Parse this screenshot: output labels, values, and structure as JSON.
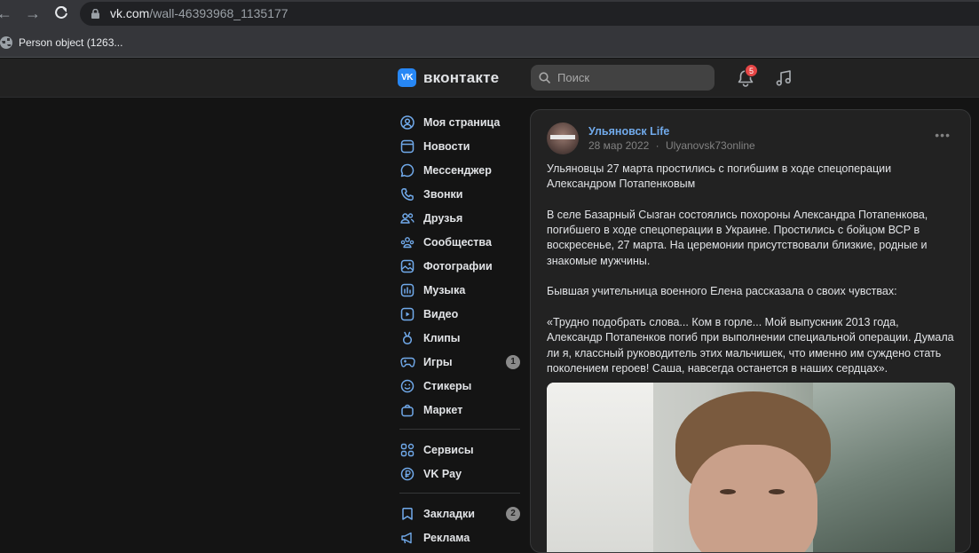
{
  "browser": {
    "url_host": "vk.com",
    "url_path": "/wall-46393968_1135177",
    "bookmark_label": "Person object (1263..."
  },
  "header": {
    "logo_text": "вконтакте",
    "search_placeholder": "Поиск",
    "notifications_count": "5"
  },
  "sidebar": {
    "items": [
      {
        "label": "Моя страница",
        "icon": "user-circle-icon"
      },
      {
        "label": "Новости",
        "icon": "news-icon"
      },
      {
        "label": "Мессенджер",
        "icon": "chat-icon"
      },
      {
        "label": "Звонки",
        "icon": "phone-icon"
      },
      {
        "label": "Друзья",
        "icon": "friends-icon"
      },
      {
        "label": "Сообщества",
        "icon": "communities-icon"
      },
      {
        "label": "Фотографии",
        "icon": "photo-icon"
      },
      {
        "label": "Музыка",
        "icon": "music-icon"
      },
      {
        "label": "Видео",
        "icon": "video-icon"
      },
      {
        "label": "Клипы",
        "icon": "clips-icon"
      },
      {
        "label": "Игры",
        "icon": "gamepad-icon",
        "count": "1"
      },
      {
        "label": "Стикеры",
        "icon": "smile-icon"
      },
      {
        "label": "Маркет",
        "icon": "bag-icon"
      }
    ],
    "items2": [
      {
        "label": "Сервисы",
        "icon": "services-icon"
      },
      {
        "label": "VK Pay",
        "icon": "vkpay-icon"
      }
    ],
    "items3": [
      {
        "label": "Закладки",
        "icon": "bookmark-icon",
        "count": "2"
      },
      {
        "label": "Реклама",
        "icon": "megaphone-icon"
      }
    ]
  },
  "post": {
    "group_name": "Ульяновск Life",
    "date": "28 мар 2022",
    "separator": "·",
    "author": "Ulyanovsk73online",
    "paragraphs": [
      "Ульяновцы 27 марта простились с погибшим в ходе спецоперации Александром Потапенковым",
      "В селе Базарный Сызган состоялись похороны Александра Потапенкова, погибшего в ходе спецоперации в Украине. Простились с бойцом ВСР в воскресенье, 27 марта. На церемонии присутствовали близкие, родные и знакомые мужчины.",
      "Бывшая учительница военного Елена рассказала о своих чувствах:",
      "«Трудно подобрать слова... Ком в горле... Мой выпускник 2013 года, Александр Потапенков погиб при выполнении специальной операции. Думала ли я, классный руководитель этих мальчишек, что именно им суждено стать поколением героев! Саша, навсегда останется в наших сердцах»."
    ]
  }
}
